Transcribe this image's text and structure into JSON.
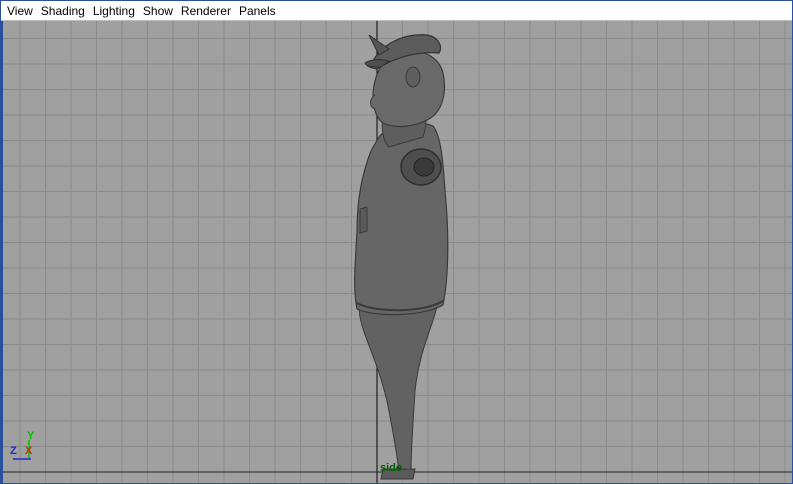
{
  "menu": {
    "items": [
      {
        "label": "View"
      },
      {
        "label": "Shading"
      },
      {
        "label": "Lighting"
      },
      {
        "label": "Show"
      },
      {
        "label": "Renderer"
      },
      {
        "label": "Panels"
      }
    ]
  },
  "viewport": {
    "camera_label": "side",
    "axes": {
      "y": "Y",
      "z": "Z",
      "x": "X"
    },
    "colors": {
      "background": "#a0a0a0",
      "grid_line": "#8a8a8a",
      "axis_line": "#222222",
      "model": "#5f5f5f",
      "axis_y": "#00c000",
      "axis_z": "#1a2fd0",
      "axis_x": "#d02a00",
      "camera_label": "#005e00"
    }
  }
}
